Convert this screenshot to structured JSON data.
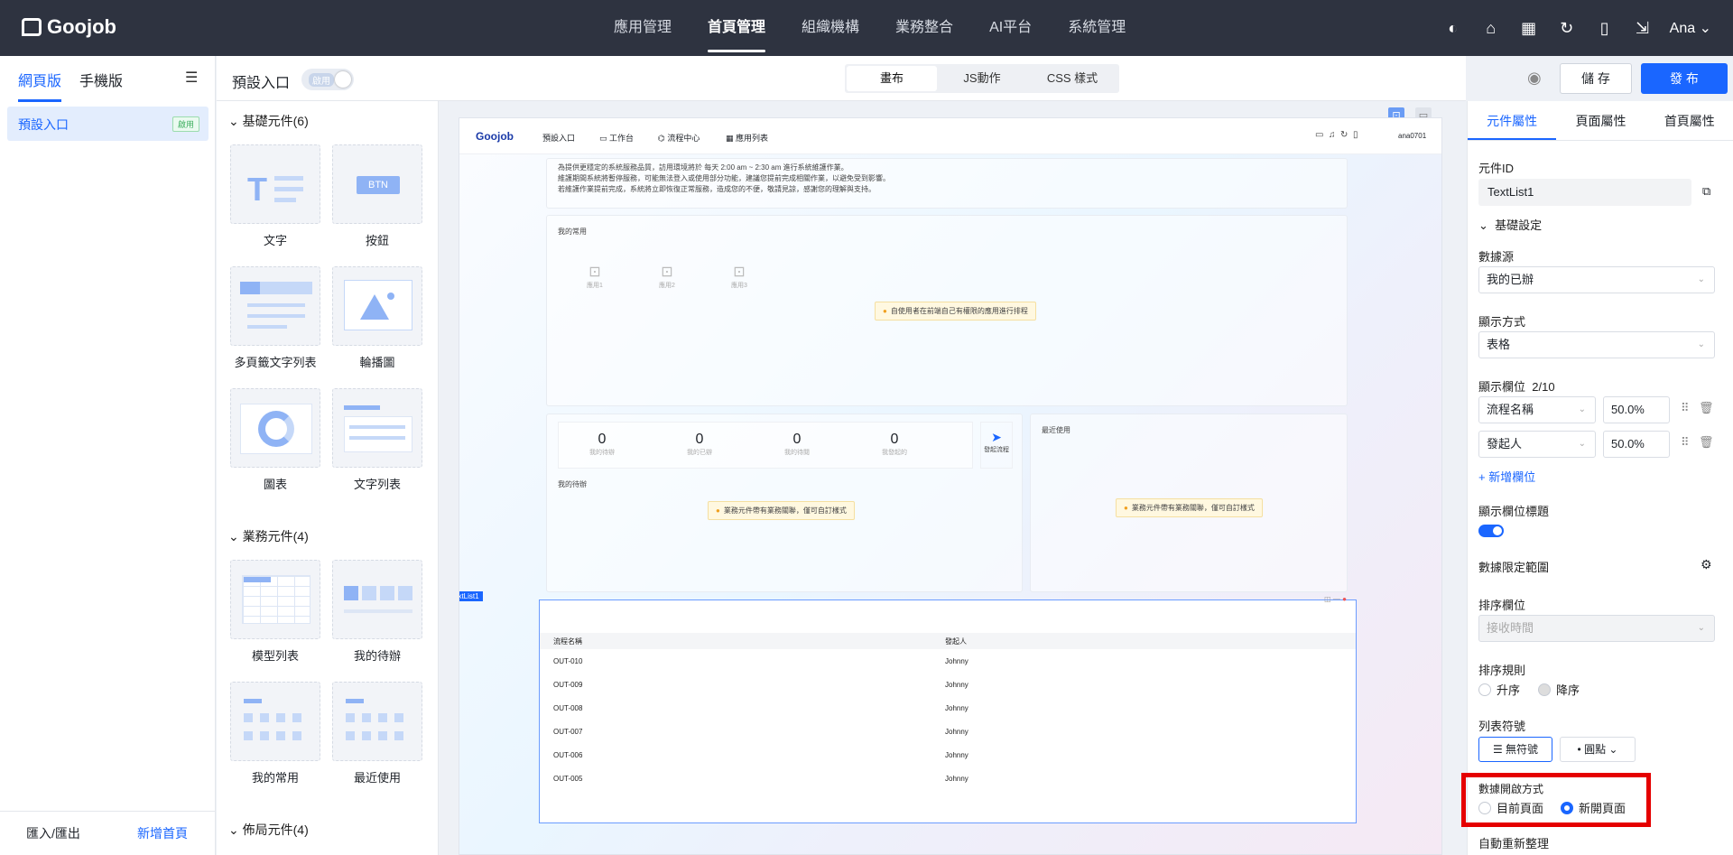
{
  "topbar": {
    "logo": "Goojob",
    "nav": [
      "應用管理",
      "首頁管理",
      "組織機構",
      "業務整合",
      "AI平台",
      "系統管理"
    ],
    "active": "首頁管理",
    "user": "Ana"
  },
  "left": {
    "tabs": [
      "網頁版",
      "手機版"
    ],
    "item": "預設入口",
    "item_badge": "啟用",
    "import": "匯入/匯出",
    "add": "新增首頁"
  },
  "header": {
    "title": "預設入口",
    "toggle": "啟用",
    "modes": [
      "畫布",
      "JS動作",
      "CSS 樣式"
    ],
    "save": "儲 存",
    "publish": "發 布"
  },
  "widgets": {
    "sec1": "基礎元件(6)",
    "sec2": "業務元件(4)",
    "sec3": "佈局元件(4)",
    "basic": [
      "文字",
      "按鈕",
      "多頁籤文字列表",
      "輪播圖",
      "圖表",
      "文字列表"
    ],
    "business": [
      "模型列表",
      "我的待辦",
      "我的常用",
      "最近使用"
    ],
    "btn_text": "BTN"
  },
  "preview": {
    "logo": "Goojob",
    "nav": [
      "預設入口",
      "工作台",
      "流程中心",
      "應用列表"
    ],
    "user": "ana0701",
    "notice": [
      "為提供更穩定的系統服務品質，訪用環境將於 每天 2:00 am ~ 2:30 am 進行系統維護作業。",
      "維護期間系統將暫停服務，可能無法登入或使用部分功能，建議您提前完成相關作業，以避免受到影響。",
      "若維護作業提前完成，系統將立即恢復正常服務，造成您的不便，敬請見諒，感謝您的理解與支持。"
    ],
    "common_title": "我的常用",
    "common_apps": [
      "應用1",
      "應用2",
      "應用3"
    ],
    "common_warn": "自使用者在前端自己有權限的應用進行排程",
    "stats": [
      {
        "n": "0",
        "l": "我的待辦"
      },
      {
        "n": "0",
        "l": "我的已辦"
      },
      {
        "n": "0",
        "l": "我的待閱"
      },
      {
        "n": "0",
        "l": "我發起的"
      }
    ],
    "launch": "發起流程",
    "todo_title": "我的待辦",
    "todo_warn": "業務元件帶有業務關聯，僅可自訂樣式",
    "recent_title": "最近使用",
    "recent_warn": "業務元件帶有業務關聯，僅可自訂樣式",
    "sel_tag": "TextList1",
    "table_headers": [
      "流程名稱",
      "發起人"
    ],
    "rows": [
      [
        "OUT-010",
        "Johnny"
      ],
      [
        "OUT-009",
        "Johnny"
      ],
      [
        "OUT-008",
        "Johnny"
      ],
      [
        "OUT-007",
        "Johnny"
      ],
      [
        "OUT-006",
        "Johnny"
      ],
      [
        "OUT-005",
        "Johnny"
      ]
    ]
  },
  "props": {
    "tabs": [
      "元件屬性",
      "頁面屬性",
      "首頁屬性"
    ],
    "id_label": "元件ID",
    "id_value": "TextList1",
    "basic": "基礎設定",
    "source_label": "數據源",
    "source": "我的已辦",
    "display_label": "顯示方式",
    "display": "表格",
    "fields_label": "顯示欄位",
    "fields_count": "2/10",
    "fields": [
      {
        "name": "流程名稱",
        "width": "50.0%"
      },
      {
        "name": "發起人",
        "width": "50.0%"
      }
    ],
    "add_field": "+ 新增欄位",
    "show_title": "顯示欄位標題",
    "range": "數據限定範圍",
    "sort_field_label": "排序欄位",
    "sort_field": "接收時間",
    "sort_rule_label": "排序規則",
    "asc": "升序",
    "desc": "降序",
    "list_sym_label": "列表符號",
    "no_sym": "無符號",
    "dot": "圓點",
    "open_label": "數據開啟方式",
    "current": "目前頁面",
    "new": "新開頁面",
    "refresh": "自動重新整理"
  }
}
